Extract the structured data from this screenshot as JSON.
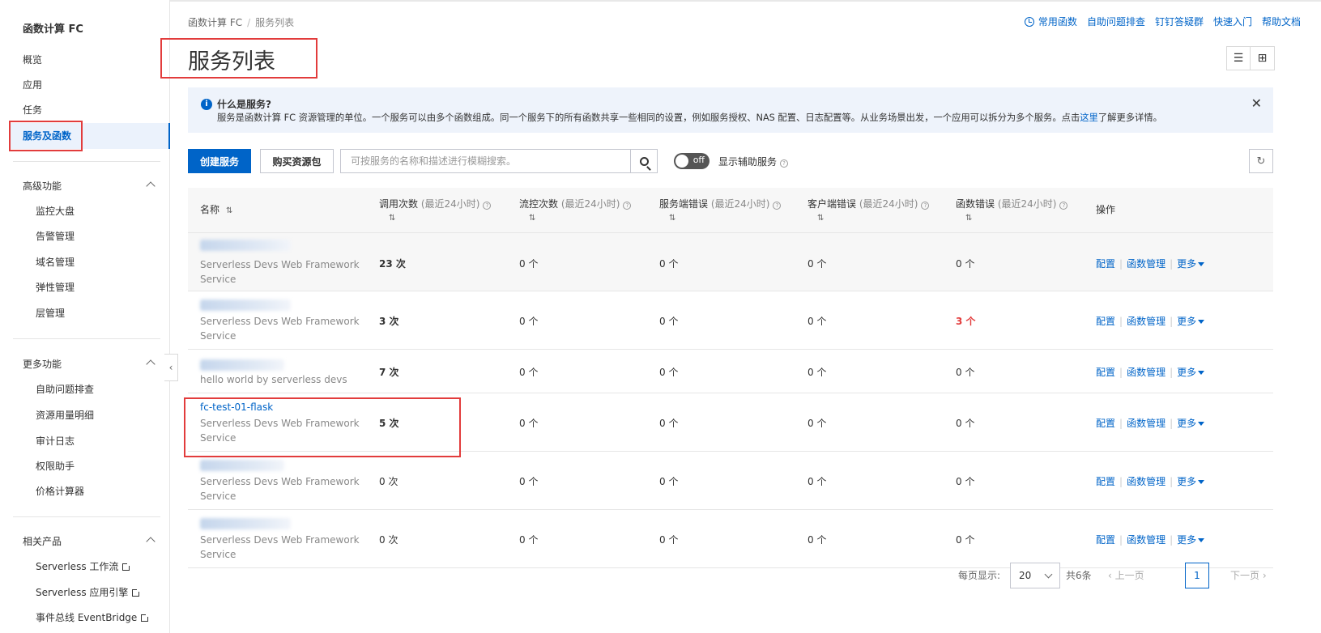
{
  "sidebar": {
    "title": "函数计算 FC",
    "items": [
      "概览",
      "应用",
      "任务",
      "服务及函数"
    ],
    "groups": [
      {
        "title": "高级功能",
        "items": [
          "监控大盘",
          "告警管理",
          "域名管理",
          "弹性管理",
          "层管理"
        ]
      },
      {
        "title": "更多功能",
        "items": [
          "自助问题排查",
          "资源用量明细",
          "审计日志",
          "权限助手",
          "价格计算器"
        ]
      },
      {
        "title": "相关产品",
        "items": [
          "Serverless 工作流",
          "Serverless 应用引擎",
          "事件总线 EventBridge"
        ]
      }
    ]
  },
  "breadcrumb": {
    "root": "函数计算 FC",
    "separator": "/",
    "current": "服务列表"
  },
  "toplinks": [
    "常用函数",
    "自助问题排查",
    "钉钉答疑群",
    "快速入门",
    "帮助文档"
  ],
  "page_title": "服务列表",
  "notice": {
    "title": "什么是服务?",
    "body": "服务是函数计算 FC 资源管理的单位。一个服务可以由多个函数组成。同一个服务下的所有函数共享一些相同的设置，例如服务授权、NAS 配置、日志配置等。从业务场景出发，一个应用可以拆分为多个服务。点击",
    "link": "这里",
    "body_after": "了解更多详情。",
    "close": "✕"
  },
  "toolbar": {
    "create_label": "创建服务",
    "buy_label": "购买资源包",
    "search_placeholder": "可按服务的名称和描述进行模糊搜索。",
    "toggle_state": "off",
    "aux_label": "显示辅助服务"
  },
  "table": {
    "headers": {
      "name": "名称",
      "invocations": "调用次数",
      "throttles": "流控次数",
      "server_errors": "服务端错误",
      "client_errors": "客户端错误",
      "function_errors": "函数错误",
      "suffix": "(最近24小时)",
      "ops": "操作"
    },
    "rows": [
      {
        "name": "",
        "desc": "Serverless Devs Web Framework Service",
        "invocations": "23 次",
        "throttles": "0 个",
        "server_errors": "0 个",
        "client_errors": "0 个",
        "function_errors": "0 个"
      },
      {
        "name": "",
        "desc": "Serverless Devs Web Framework Service",
        "invocations": "3 次",
        "throttles": "0 个",
        "server_errors": "0 个",
        "client_errors": "0 个",
        "function_errors": "3 个"
      },
      {
        "name": "",
        "desc": "hello world by serverless devs",
        "invocations": "7 次",
        "throttles": "0 个",
        "server_errors": "0 个",
        "client_errors": "0 个",
        "function_errors": "0 个"
      },
      {
        "name": "fc-test-01-flask",
        "desc": "Serverless Devs Web Framework Service",
        "invocations": "5 次",
        "throttles": "0 个",
        "server_errors": "0 个",
        "client_errors": "0 个",
        "function_errors": "0 个"
      },
      {
        "name": "",
        "desc": "Serverless Devs Web Framework Service",
        "invocations": "0 次",
        "throttles": "0 个",
        "server_errors": "0 个",
        "client_errors": "0 个",
        "function_errors": "0 个"
      },
      {
        "name": "",
        "desc": "Serverless Devs Web Framework Service",
        "invocations": "0 次",
        "throttles": "0 个",
        "server_errors": "0 个",
        "client_errors": "0 个",
        "function_errors": "0 个"
      }
    ],
    "ops": {
      "config": "配置",
      "functions": "函数管理",
      "more": "更多"
    }
  },
  "pagination": {
    "per_page_label": "每页显示:",
    "per_page_value": "20",
    "total": "共6条",
    "prev": "上一页",
    "current": "1",
    "next": "下一页"
  },
  "colors": {
    "primary": "#0064c8",
    "error": "#e23c3c",
    "highlight_box": "#e23c3c",
    "notice_bg": "#eef3fb"
  }
}
